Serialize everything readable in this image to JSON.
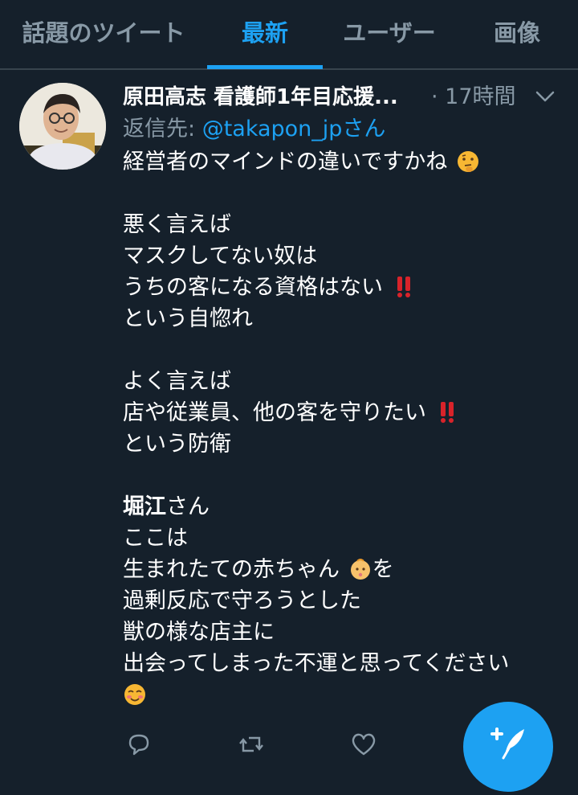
{
  "tabs": [
    {
      "label": "話題のツイート"
    },
    {
      "label": "最新"
    },
    {
      "label": "ユーザー"
    },
    {
      "label": "画像"
    }
  ],
  "active_tab": "最新",
  "tweet": {
    "author_name": "原田高志 看護師1年目応援...",
    "separator": " · ",
    "time": "17時間",
    "reply_prefix": "返信先: ",
    "reply_to": "@takapon_jpさん",
    "lines": [
      "経営者のマインドの違いですかね",
      "",
      "悪く言えば",
      "マスクしてない奴は",
      "うちの客になる資格はない",
      "という自惚れ",
      "",
      "よく言えば",
      "店や従業員、他の客を守りたい",
      "という防衛",
      "",
      "堀江",
      "さん",
      "ここは",
      "生まれたての赤ちゃん",
      "を",
      "過剰反応で守ろうとした",
      "獣の様な店主に",
      "出会ってしまった不運と思ってください"
    ],
    "emojis": {
      "thinking": "thinking-face-emoji",
      "exclamation": "double-exclamation-emoji",
      "baby": "baby-emoji",
      "smiling": "smiling-face-emoji"
    }
  },
  "actions": {
    "reply": "reply-icon",
    "retweet": "retweet-icon",
    "like": "like-icon",
    "compose": "compose-tweet-icon"
  },
  "colors": {
    "background": "#15202b",
    "accent": "#1da1f2",
    "muted": "#8899a6",
    "divider": "#38444d"
  }
}
